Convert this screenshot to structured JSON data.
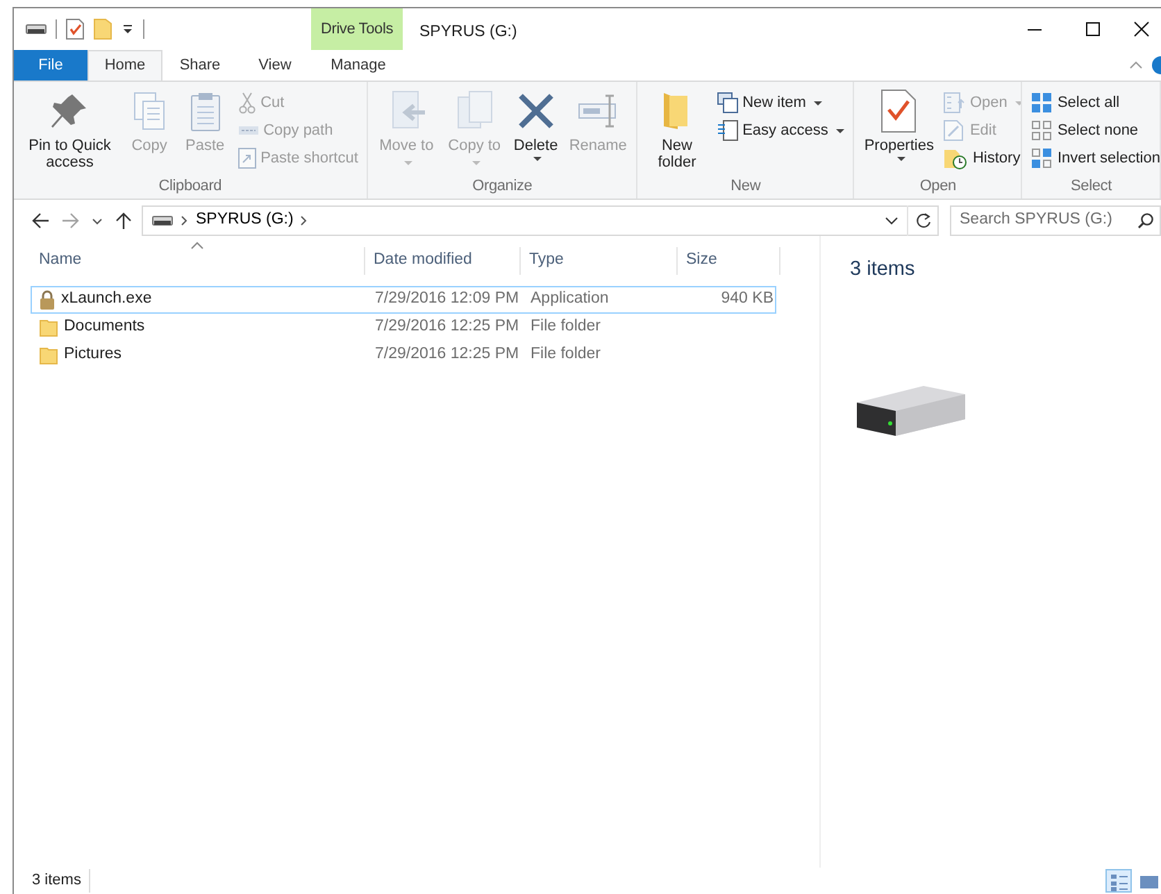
{
  "window": {
    "title": "SPYRUS (G:)",
    "contextual_header": "Drive Tools"
  },
  "tabs": [
    {
      "label": "File",
      "kind": "file",
      "selected": false
    },
    {
      "label": "Home",
      "kind": "normal",
      "selected": true
    },
    {
      "label": "Share",
      "kind": "normal",
      "selected": false
    },
    {
      "label": "View",
      "kind": "normal",
      "selected": false
    },
    {
      "label": "Manage",
      "kind": "contextual",
      "selected": false
    }
  ],
  "ribbon": [
    {
      "label": "Clipboard",
      "items": [
        {
          "kind": "large",
          "label": "Pin to Quick access",
          "disabled": false,
          "dropdown": false
        },
        {
          "kind": "large",
          "label": "Copy",
          "disabled": true,
          "dropdown": false
        },
        {
          "kind": "large",
          "label": "Paste",
          "disabled": true,
          "dropdown": false
        },
        {
          "kind": "stack",
          "items": [
            {
              "label": "Cut",
              "disabled": true,
              "dropdown": false
            },
            {
              "label": "Copy path",
              "disabled": true,
              "dropdown": false
            },
            {
              "label": "Paste shortcut",
              "disabled": true,
              "dropdown": false
            }
          ]
        }
      ]
    },
    {
      "label": "Organize",
      "items": [
        {
          "kind": "large",
          "label": "Move to",
          "disabled": true,
          "dropdown": true
        },
        {
          "kind": "large",
          "label": "Copy to",
          "disabled": true,
          "dropdown": true
        },
        {
          "kind": "large",
          "label": "Delete",
          "disabled": false,
          "dropdown": true
        },
        {
          "kind": "large",
          "label": "Rename",
          "disabled": true,
          "dropdown": false
        }
      ]
    },
    {
      "label": "New",
      "items": [
        {
          "kind": "large",
          "label": "New folder",
          "disabled": false,
          "dropdown": false
        },
        {
          "kind": "stack",
          "items": [
            {
              "label": "New item",
              "disabled": false,
              "dropdown": true
            },
            {
              "label": "Easy access",
              "disabled": false,
              "dropdown": true
            }
          ]
        }
      ]
    },
    {
      "label": "Open",
      "items": [
        {
          "kind": "large",
          "label": "Properties",
          "disabled": false,
          "dropdown": true
        },
        {
          "kind": "stack",
          "items": [
            {
              "label": "Open",
              "disabled": true,
              "dropdown": true
            },
            {
              "label": "Edit",
              "disabled": true,
              "dropdown": false
            },
            {
              "label": "History",
              "disabled": false,
              "dropdown": false
            }
          ]
        }
      ]
    },
    {
      "label": "Select",
      "items": [
        {
          "kind": "stack",
          "items": [
            {
              "label": "Select all",
              "disabled": false,
              "dropdown": false
            },
            {
              "label": "Select none",
              "disabled": false,
              "dropdown": false
            },
            {
              "label": "Invert selection",
              "disabled": false,
              "dropdown": false
            }
          ]
        }
      ]
    }
  ],
  "navigation": [
    {
      "disabled": false
    },
    {
      "disabled": true
    },
    {
      "disabled": false
    },
    {
      "disabled": false
    }
  ],
  "address": {
    "path": [
      "SPYRUS (G:)"
    ]
  },
  "search": {
    "placeholder": "Search SPYRUS (G:)"
  },
  "file_list": {
    "columns": [
      {
        "label": "Name",
        "sorted": true
      },
      {
        "label": "Date modified",
        "sorted": false
      },
      {
        "label": "Type",
        "sorted": false
      },
      {
        "label": "Size",
        "sorted": false
      }
    ],
    "rows": [
      {
        "kind": "application",
        "name": "xLaunch.exe",
        "date": "7/29/2016 12:09 PM",
        "type": "Application",
        "size": "940 KB",
        "focused": true,
        "selected": false
      },
      {
        "kind": "folder",
        "name": "Documents",
        "date": "7/29/2016 12:25 PM",
        "type": "File folder",
        "focused": false,
        "selected": false
      },
      {
        "kind": "folder",
        "name": "Pictures",
        "date": "7/29/2016 12:25 PM",
        "type": "File folder",
        "focused": false,
        "selected": false
      }
    ]
  },
  "preview": {
    "count": "3 items"
  },
  "status_bar": {
    "count": "3 items",
    "views": [
      {
        "selected": true
      },
      {
        "selected": false
      }
    ]
  }
}
